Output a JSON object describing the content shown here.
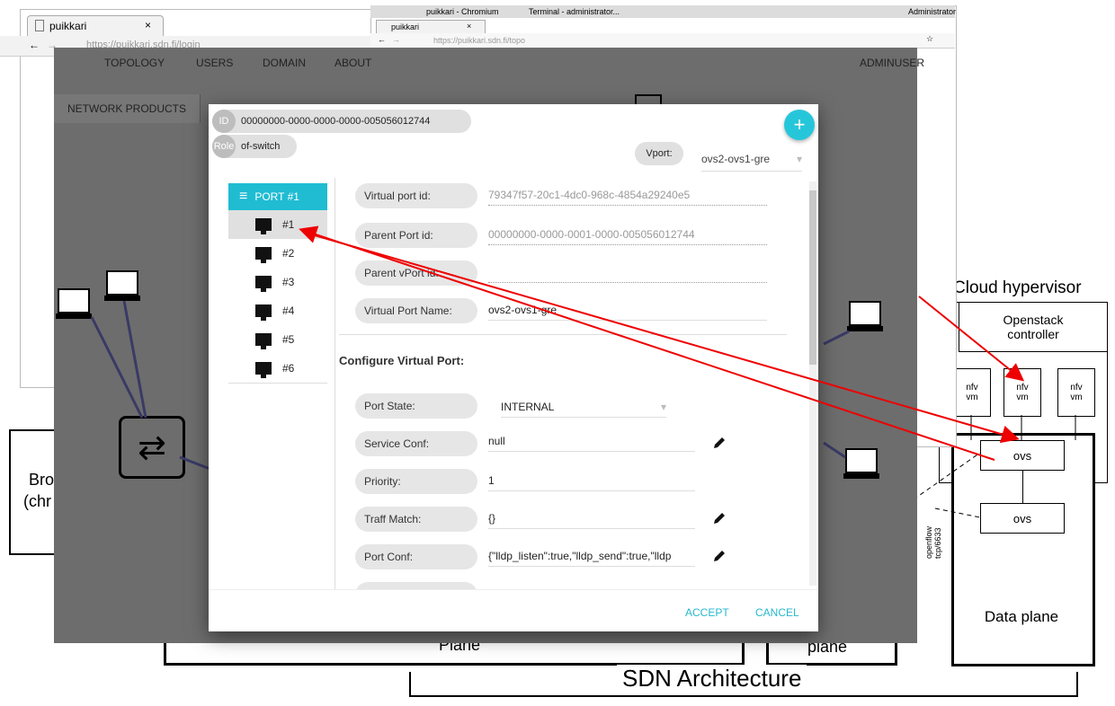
{
  "back_browser": {
    "tab_title": "puikkari",
    "tab_close": "×",
    "address": "https://puikkari.sdn.fi/login"
  },
  "front_browser": {
    "taskbar": {
      "window1": "puikkari - Chromium",
      "window2": "Terminal - administrator...",
      "right_label": "Administrator"
    },
    "tab_title": "puikkari",
    "tab_close": "×",
    "address": "https://puikkari.sdn.fi/topo"
  },
  "app": {
    "nav": [
      "TOPOLOGY",
      "USERS",
      "DOMAIN",
      "ABOUT"
    ],
    "user": "ADMINUSER",
    "sidebar_button": "NETWORK PRODUCTS"
  },
  "dialog": {
    "id_lead": "ID",
    "id_value": "00000000-0000-0000-0000-005056012744",
    "role_lead": "Role",
    "role_value": "of-switch",
    "add_label": "+",
    "vport_label": "Vport:",
    "vport_value": "ovs2-ovs1-gre",
    "ports_header": "PORT #1",
    "ports": [
      "#1",
      "#2",
      "#3",
      "#4",
      "#5",
      "#6"
    ],
    "fields": {
      "virtual_port_id": {
        "label": "Virtual port id:",
        "value": "79347f57-20c1-4dc0-968c-4854a29240e5"
      },
      "parent_port_id": {
        "label": "Parent Port id:",
        "value": "00000000-0000-0001-0000-005056012744"
      },
      "parent_vport_id": {
        "label": "Parent vPort id:",
        "value": ""
      },
      "virtual_port_name": {
        "label": "Virtual Port Name:",
        "value": "ovs2-ovs1-gre"
      }
    },
    "configure_heading": "Configure Virtual Port:",
    "config": {
      "port_state": {
        "label": "Port State:",
        "value": "INTERNAL"
      },
      "service_conf": {
        "label": "Service Conf:",
        "value": "null"
      },
      "priority": {
        "label": "Priority:",
        "value": "1"
      },
      "traff_match": {
        "label": "Traff Match:",
        "value": "{}"
      },
      "port_conf": {
        "label": "Port Conf:",
        "value": "{\"lldp_listen\":true,\"lldp_send\":true,\"lldp"
      }
    },
    "accept_label": "ACCEPT",
    "cancel_label": "CANCEL"
  },
  "diagram": {
    "cloud_hypervisor": "Cloud hypervisor",
    "openstack_controller": "Openstack controller",
    "nfv_vm": "nfv vm",
    "ovs": "ovs",
    "openflow": "openflow tcp/6633",
    "data_plane": "Data plane",
    "sdn_architecture": "SDN Architecture",
    "plane_left": "Plane",
    "plane_mid": "plane",
    "browser_label_1": "Bro",
    "browser_label_2": "(chr"
  }
}
